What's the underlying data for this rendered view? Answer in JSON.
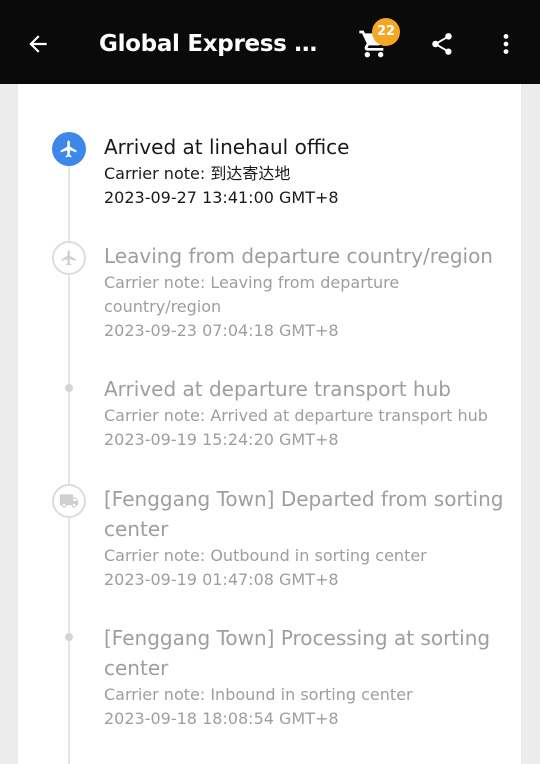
{
  "header": {
    "title": "Global Express Tr...",
    "cart_count": "22",
    "accent_badge": "#f5a623"
  },
  "events": [
    {
      "title": "Arrived at linehaul office",
      "note": "Carrier note: 到达寄达地",
      "time": "2023-09-27 13:41:00 GMT+8",
      "icon": "airplane-icon",
      "state": "active"
    },
    {
      "title": "Leaving from departure country/region",
      "note": "Carrier note: Leaving from departure country/region",
      "time": "2023-09-23 07:04:18 GMT+8",
      "icon": "airplane-icon",
      "state": "past"
    },
    {
      "title": "Arrived at departure transport hub",
      "note": "Carrier note: Arrived at departure transport hub",
      "time": "2023-09-19 15:24:20 GMT+8",
      "icon": "dot",
      "state": "past"
    },
    {
      "title": "[Fenggang Town] Departed from sorting center",
      "note": "Carrier note: Outbound in sorting center",
      "time": "2023-09-19 01:47:08 GMT+8",
      "icon": "truck-icon",
      "state": "past"
    },
    {
      "title": "[Fenggang Town] Processing at sorting center",
      "note": "Carrier note: Inbound in sorting center",
      "time": "2023-09-18 18:08:54 GMT+8",
      "icon": "dot",
      "state": "past"
    }
  ]
}
